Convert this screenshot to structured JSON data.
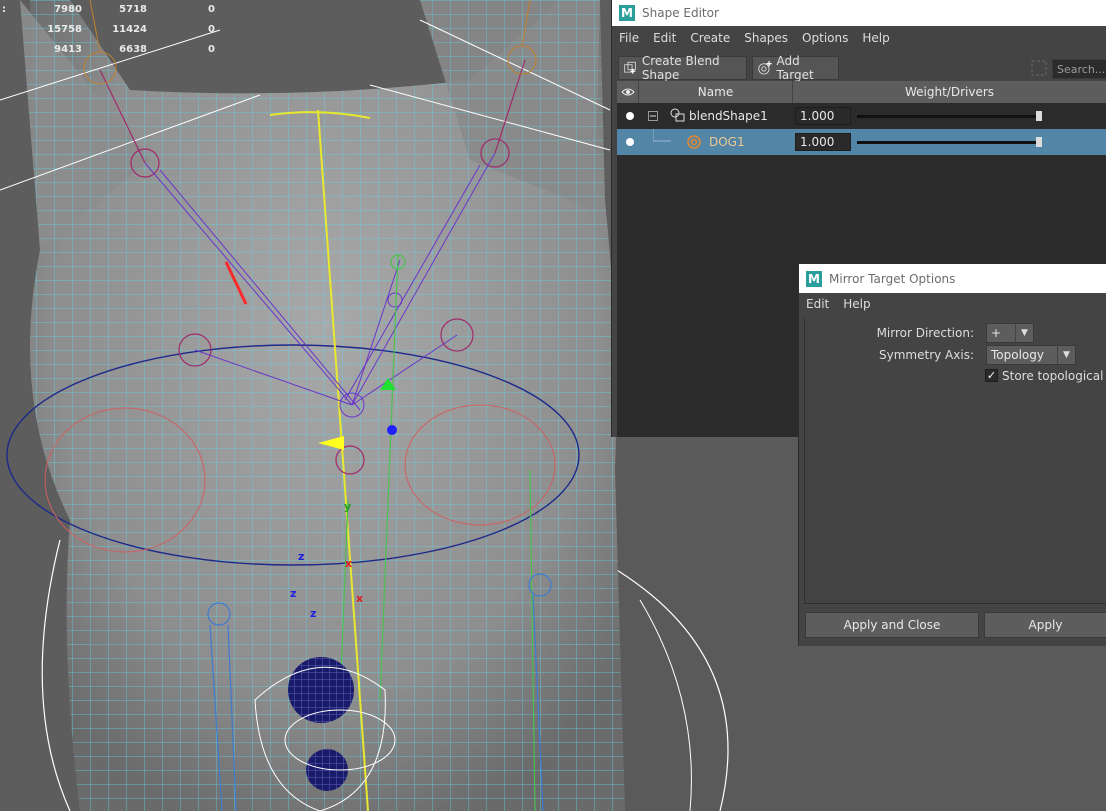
{
  "viewport": {
    "hud_stats": [
      {
        "col1": "7980",
        "col2": "5718",
        "col3": "0"
      },
      {
        "col1": "15758",
        "col2": "11424",
        "col3": "0"
      },
      {
        "col1": "9413",
        "col2": "6638",
        "col3": "0"
      }
    ],
    "hud_edge_label": ":",
    "axis_labels": [
      "y",
      "z",
      "z",
      "z",
      "x",
      "x"
    ]
  },
  "shape_editor": {
    "title": "Shape Editor",
    "menu": [
      "File",
      "Edit",
      "Create",
      "Shapes",
      "Options",
      "Help"
    ],
    "create_blend_shape_label": "Create Blend Shape",
    "add_target_label": "Add Target",
    "search_placeholder": "Search...",
    "columns": {
      "name": "Name",
      "weight": "Weight/Drivers"
    },
    "rows": [
      {
        "name": "blendShape1",
        "weight": "1.000",
        "weight_fraction": 1.0,
        "selected": false
      },
      {
        "name": "DOG1",
        "weight": "1.000",
        "weight_fraction": 1.0,
        "selected": true
      }
    ]
  },
  "mirror_options": {
    "title": "Mirror Target Options",
    "menu": [
      "Edit",
      "Help"
    ],
    "mirror_direction_label": "Mirror Direction:",
    "mirror_direction_value": "+",
    "symmetry_axis_label": "Symmetry Axis:",
    "symmetry_axis_value": "Topology",
    "store_topological_label": "Store topological sym",
    "store_topological_checked": true,
    "apply_close_label": "Apply and Close",
    "apply_label": "Apply"
  },
  "colors": {
    "wire": "#5fd3e8",
    "selected_row": "#5285a6",
    "joint": "#a02a6a",
    "bone_blue": "#4a58d0"
  },
  "icons": {
    "logo": "maya-m-logo",
    "eye": "eye-icon",
    "blend_shape": "blend-shape-icon",
    "target": "target-icon",
    "create_blend": "create-blend-shape-icon",
    "add_target": "add-target-icon"
  }
}
